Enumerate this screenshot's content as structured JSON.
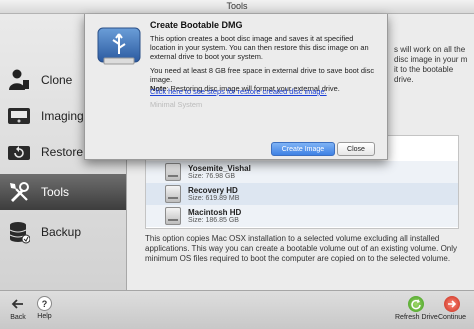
{
  "window": {
    "title": "Tools"
  },
  "sidebar": {
    "items": [
      {
        "label": "Clone"
      },
      {
        "label": "Imaging"
      },
      {
        "label": "Restore"
      },
      {
        "label": "Tools"
      },
      {
        "label": "Backup"
      }
    ]
  },
  "main": {
    "right_text": "s will work on all the disc image in your m it to the bootable drive.",
    "drives": [
      {
        "name": "Yosemite_Vishal",
        "size": "Size: 76.98 GB"
      },
      {
        "name": "Recovery HD",
        "size": "Size: 619.89 MB"
      },
      {
        "name": "Macintosh HD",
        "size": "Size: 186.85 GB"
      }
    ],
    "description": "This option copies Mac OSX installation to a selected volume excluding all installed applications. This way you can create a bootable volume out of an existing volume. Only minimum OS files required to boot the computer are copied on to the selected volume."
  },
  "dialog": {
    "title": "Create Bootable DMG",
    "paragraph1": "This option creates a boot disc image and saves it at specified location in your system. You can then restore this disc image on an external drive to boot your system.",
    "paragraph2_prefix": "You need at least 8 GB free space in external drive to save boot disc image.",
    "note_label": "Note",
    "note_text": ": Restoring disc image will format your external drive.",
    "link": "Click here to see steps for restore created disc image.",
    "ghost_text": "Minimal System",
    "primary_button": "Create Image",
    "secondary_button": "Close"
  },
  "bottombar": {
    "back": "Back",
    "help": "Help",
    "refresh": "Refresh Drive",
    "continue": "Continue"
  }
}
